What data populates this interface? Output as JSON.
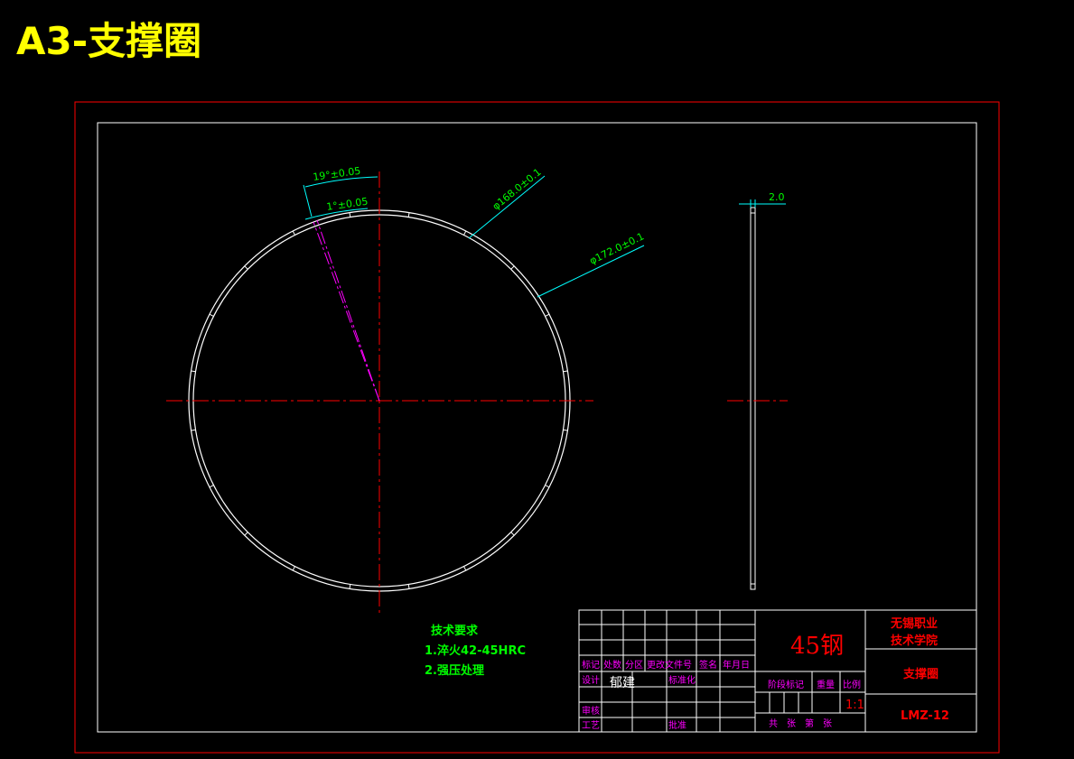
{
  "sheet": {
    "title": "A3-支撑圈"
  },
  "dimensions": {
    "angle_19": "19°±0.05",
    "angle_1": "1°±0.05",
    "dia_inner": "φ168.0±0.1",
    "dia_outer": "φ172.0±0.1",
    "thickness": "2.0"
  },
  "tech_req": {
    "heading": "技术要求",
    "item1": "1.淬火42-45HRC",
    "item2": "2.强压处理"
  },
  "title_block": {
    "material": "45钢",
    "school_line1": "无锡职业",
    "school_line2": "技术学院",
    "part_name": "支撑圈",
    "drawing_no": "LMZ-12",
    "scale": "1:1",
    "designer": "郁建",
    "labels": {
      "mark": "标记",
      "count": "处数",
      "zone": "分区",
      "change_doc": "更改文件号",
      "sign": "签名",
      "date": "年月日",
      "design": "设计",
      "standardize": "标准化",
      "review": "审核",
      "process": "工艺",
      "approve": "批准",
      "stage_mark": "阶段标记",
      "weight": "重量",
      "ratio": "比例",
      "sheets": "共　张　第　张"
    }
  },
  "colors": {
    "background": "#000000",
    "title": "#ffff00",
    "outer_frame": "#ff0000",
    "geometry": "#ffffff",
    "centerline": "#ff0000",
    "dimension": "#00ffff",
    "dim_text": "#00ff00",
    "tech_text": "#00ff00",
    "label": "#ff00ff",
    "red_text": "#ff0000"
  }
}
